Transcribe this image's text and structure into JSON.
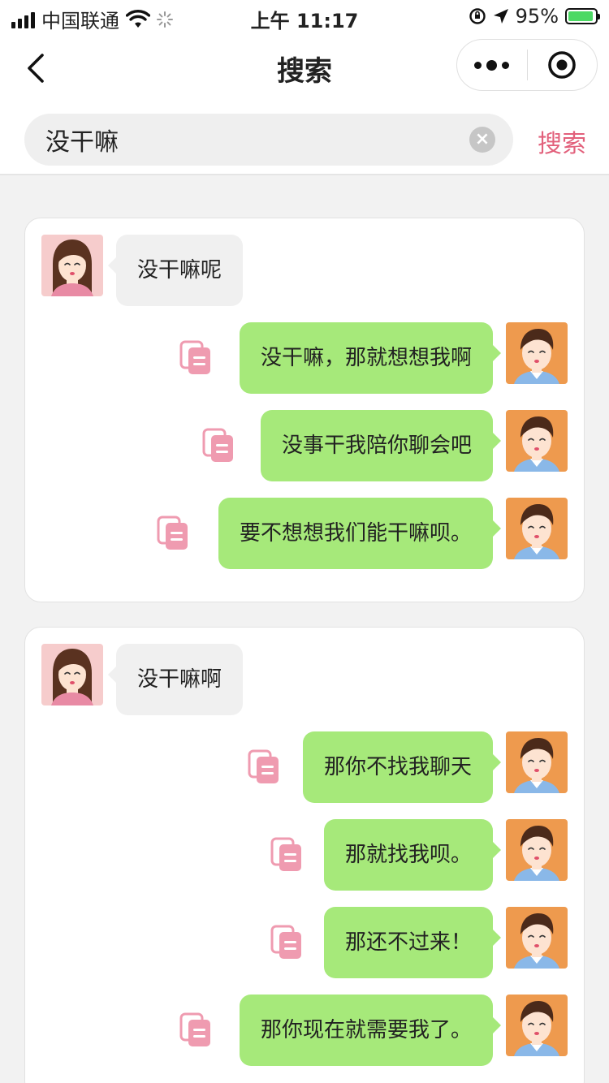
{
  "status_bar": {
    "carrier": "中国联通",
    "time": "上午 11:17",
    "battery": "95%"
  },
  "nav": {
    "title": "搜索"
  },
  "search": {
    "value": "没干嘛",
    "button_label": "搜索"
  },
  "colors": {
    "accent": "#e2607b",
    "my_bubble": "#a6e97a",
    "her_bubble": "#f0f0f0",
    "copy_icon": "#ef9bb0"
  },
  "results": [
    {
      "question": "没干嘛呢",
      "replies": [
        "没干嘛，那就想想我啊",
        "没事干我陪你聊会吧",
        "要不想想我们能干嘛呗。"
      ]
    },
    {
      "question": "没干嘛啊",
      "replies": [
        "那你不找我聊天",
        "那就找我呗。",
        "那还不过来！",
        "那你现在就需要我了。"
      ]
    }
  ]
}
